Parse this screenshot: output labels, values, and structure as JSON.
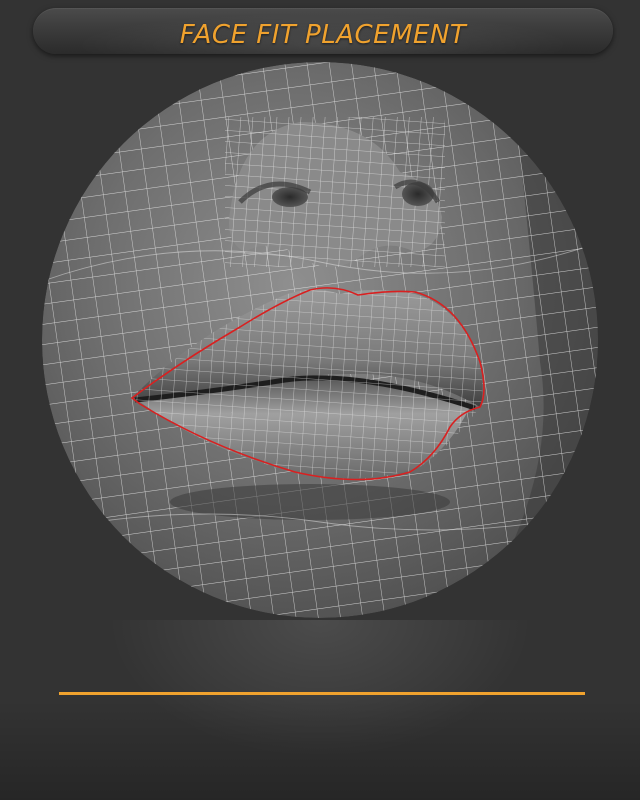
{
  "header": {
    "title": "FACE FIT PLACEMENT"
  },
  "colors": {
    "accent": "#f0a22e",
    "background": "#333333",
    "lip_outline": "#d92020",
    "wireframe": "#e8e8e8"
  },
  "icons": {
    "viewport": "lips-wireframe-render"
  }
}
